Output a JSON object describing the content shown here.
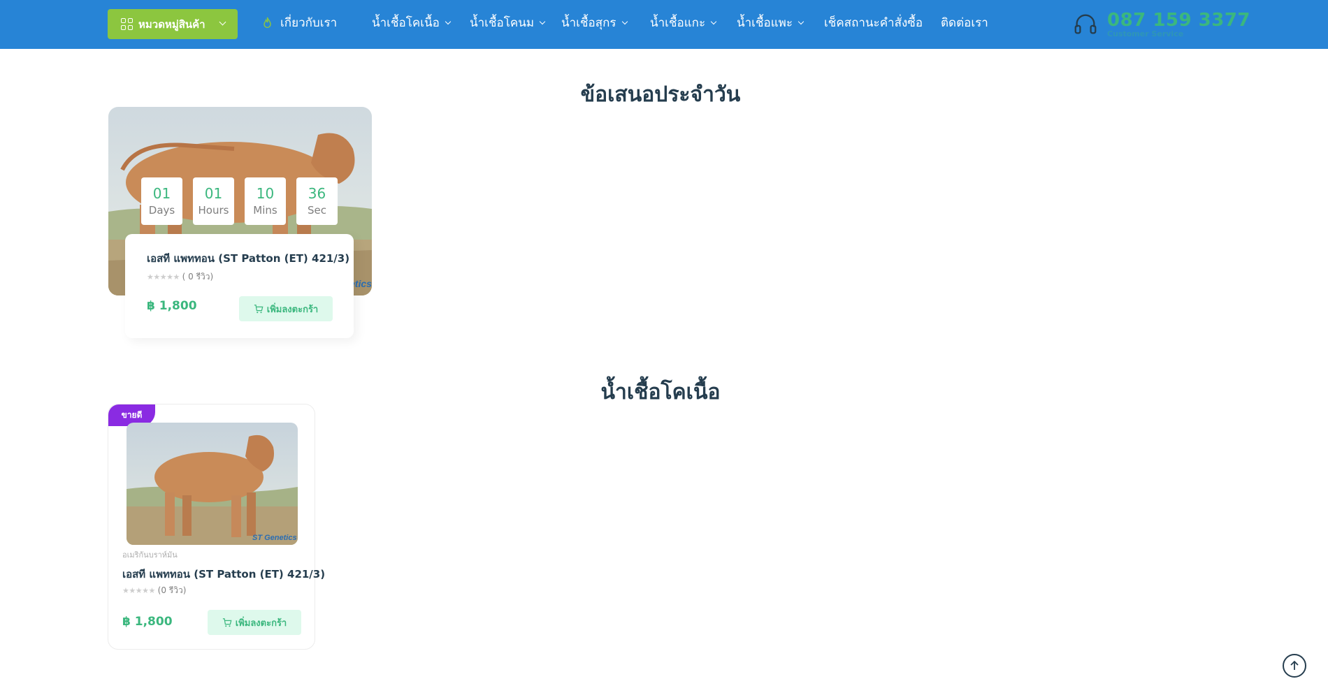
{
  "header": {
    "category_button": "หมวดหมู่สินค้า",
    "nav": [
      {
        "label": "เกี่ยวกับเรา"
      },
      {
        "label": "น้ำเชื้อโคเนื้อ"
      },
      {
        "label": "น้ำเชื้อโคนม"
      },
      {
        "label": "น้ำเชื้อสุกร"
      },
      {
        "label": "น้ำเชื้อแกะ"
      },
      {
        "label": "น้ำเชื้อแพะ"
      },
      {
        "label": "เช็คสถานะคำสั่งซื้อ"
      },
      {
        "label": "ติดต่อเรา"
      }
    ],
    "phone": "087 159 3377",
    "phone_caption": "Customer Service"
  },
  "deals": {
    "title": "ข้อเสนอประจำวัน",
    "countdown": [
      {
        "value": "01",
        "unit": "Days"
      },
      {
        "value": "01",
        "unit": "Hours"
      },
      {
        "value": "10",
        "unit": "Mins"
      },
      {
        "value": "36",
        "unit": "Sec"
      }
    ],
    "product": {
      "name": "เอสที แพททอน (ST Patton (ET) 421/3)",
      "rating_stars": "★★★★★",
      "rating_text": "( 0 รีวิว)",
      "price": "฿ 1,800",
      "add_label": "เพิ่มลงตะกร้า",
      "image_watermark": "etics"
    }
  },
  "beef": {
    "title": "น้ำเชื้อโคเนื้อ",
    "product": {
      "badge": "ขายดี",
      "category": "อเมริกันบราห์มัน",
      "name": "เอสที แพททอน (ST Patton (ET) 421/3)",
      "rating_stars": "★★★★★",
      "rating_text": "(0 รีวิว)",
      "price": "฿ 1,800",
      "add_label": "เพิ่มลงตะกร้า",
      "image_watermark": "ST Genetics"
    }
  },
  "colors": {
    "header_bg": "#2784d6",
    "category_button": "#8cc63f",
    "brand_green": "#3bb77e",
    "badge_purple": "#8a2be2",
    "heading": "#253d4e"
  },
  "icons": [
    "grid-icon",
    "chevron-down-icon",
    "fire-icon",
    "headset-icon",
    "cart-icon",
    "arrow-up-icon"
  ]
}
